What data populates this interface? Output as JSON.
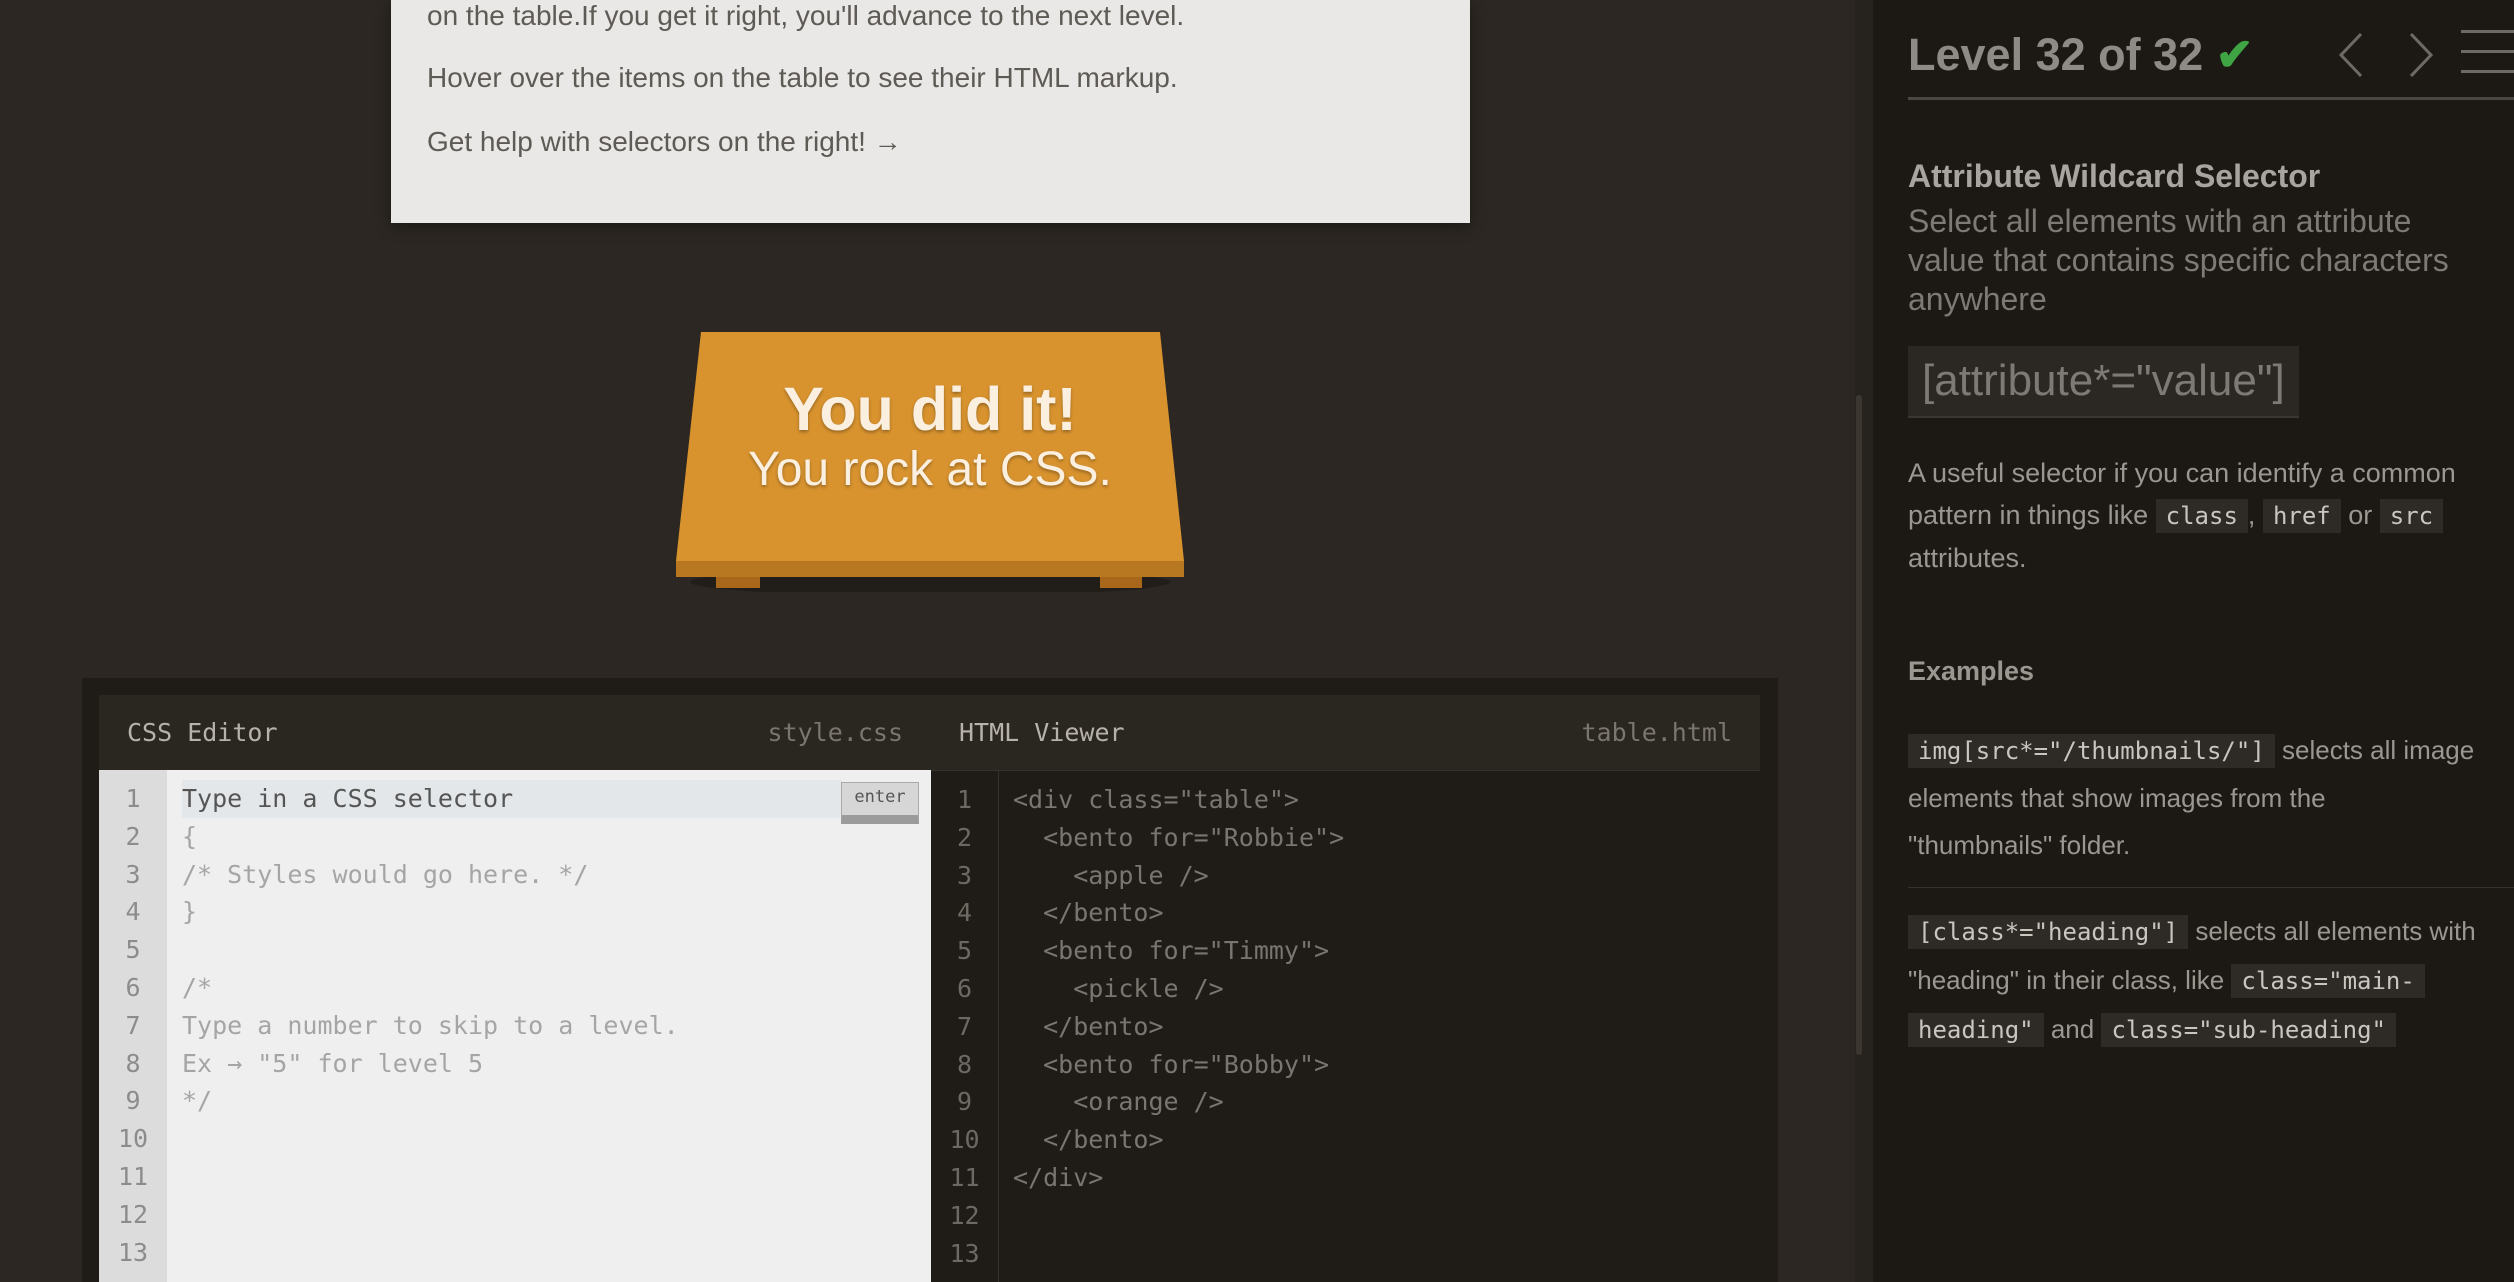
{
  "instructions": {
    "lines": [
      "on the table.If you get it right, you'll advance to the next level.",
      "Hover over the items on the table to see their HTML markup.",
      "Get help with selectors on the right! →"
    ]
  },
  "table": {
    "win_title": "You did it!",
    "win_sub": "You rock at CSS.",
    "color": "#d8932f"
  },
  "css_editor": {
    "title": "CSS Editor",
    "file": "style.css",
    "enter_label": "enter",
    "placeholder": "Type in a CSS selector",
    "lines": [
      "Type in a CSS selector",
      "{",
      "/* Styles would go here. */",
      "}",
      "",
      "/*",
      "Type a number to skip to a level.",
      "Ex → \"5\" for level 5",
      "*/",
      "",
      "",
      "",
      ""
    ],
    "line_numbers": [
      "1",
      "2",
      "3",
      "4",
      "5",
      "6",
      "7",
      "8",
      "9",
      "10",
      "11",
      "12",
      "13"
    ]
  },
  "html_viewer": {
    "title": "HTML Viewer",
    "file": "table.html",
    "lines": [
      "<div class=\"table\">",
      "  <bento for=\"Robbie\">",
      "    <apple />",
      "  </bento>",
      "  <bento for=\"Timmy\">",
      "    <pickle />",
      "  </bento>",
      "  <bento for=\"Bobby\">",
      "    <orange />",
      "  </bento>",
      "</div>",
      "",
      ""
    ],
    "line_numbers": [
      "1",
      "2",
      "3",
      "4",
      "5",
      "6",
      "7",
      "8",
      "9",
      "10",
      "11",
      "12",
      "13"
    ]
  },
  "sidebar": {
    "level": "Level 32 of 32",
    "check_color": "#3fa443",
    "selector_name": "Attribute Wildcard Selector",
    "description_lines": [
      "Select all elements with an attribute",
      "value that contains specific characters",
      "anywhere"
    ],
    "syntax": "[attribute*=\"value\"]",
    "hint": {
      "t1": "A useful selector if you can identify a common",
      "t2": "pattern in things like",
      "c1": "class",
      "sep1": ",",
      "c2": "href",
      "sep2": "or",
      "c3": "src",
      "t3": "attributes."
    },
    "examples_title": "Examples",
    "ex1": {
      "code": "img[src*=\"/thumbnails/\"]",
      "t1": "selects all image",
      "t2": "elements that show images from the",
      "t3": "\"thumbnails\" folder."
    },
    "ex2": {
      "code": "[class*=\"heading\"]",
      "t1": "selects all elements with",
      "t2": "\"heading\" in their class, like",
      "c2": "class=\"main-",
      "c3": "heading\"",
      "and": "and",
      "c4": "class=\"sub-heading\""
    }
  }
}
